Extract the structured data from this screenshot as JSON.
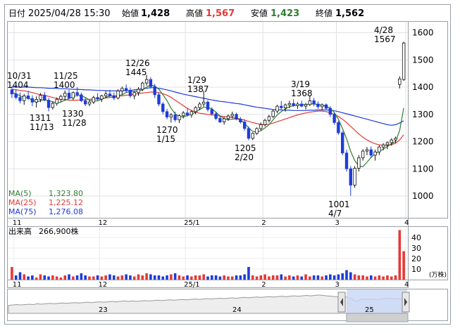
{
  "header": {
    "date_label": "日付",
    "datetime": "2025/04/28 15:30",
    "open_label": "始値",
    "open": "1,428",
    "high_label": "高値",
    "high": "1,567",
    "low_label": "安値",
    "low": "1,423",
    "close_label": "終値",
    "close": "1,562"
  },
  "ma_legend": [
    {
      "label": "MA(5)",
      "value": "1,323.80",
      "color": "#2e7d32"
    },
    {
      "label": "MA(25)",
      "value": "1,225.12",
      "color": "#e53935"
    },
    {
      "label": "MA(75)",
      "value": "1,276.08",
      "color": "#1e3cd8"
    }
  ],
  "volume_legend": {
    "label": "出来高",
    "value": "266,900株"
  },
  "volume_unit": "(万株)",
  "colors": {
    "up": "#e53935",
    "down": "#1e3cd8",
    "ma5": "#2e7d32",
    "ma25": "#e53935",
    "ma75": "#1e3cd8",
    "high_text": "#e53935",
    "low_text": "#2e7d32"
  },
  "chart_data": [
    {
      "type": "candlestick",
      "x_labels": [
        "11",
        "12",
        "25/1",
        "2",
        "3",
        "4"
      ],
      "ylim": [
        920,
        1640
      ],
      "y_ticks": [
        1000,
        1100,
        1200,
        1300,
        1400,
        1500,
        1600
      ],
      "grid": true,
      "annotations": [
        {
          "date": "10/31",
          "value": "1404"
        },
        {
          "date": "11/13",
          "value": "1311"
        },
        {
          "date": "11/25",
          "value": "1400"
        },
        {
          "date": "11/28",
          "value": "1330"
        },
        {
          "date": "12/26",
          "value": "1445"
        },
        {
          "date": "1/15",
          "value": "1270"
        },
        {
          "date": "1/29",
          "value": "1387"
        },
        {
          "date": "2/20",
          "value": "1205"
        },
        {
          "date": "3/19",
          "value": "1368"
        },
        {
          "date": "4/7",
          "value": "1001"
        },
        {
          "date": "4/28",
          "value": "1567"
        }
      ],
      "candles": [
        [
          1390,
          1404,
          1360,
          1375
        ],
        [
          1375,
          1392,
          1355,
          1362
        ],
        [
          1362,
          1380,
          1340,
          1350
        ],
        [
          1350,
          1375,
          1335,
          1368
        ],
        [
          1368,
          1386,
          1352,
          1358
        ],
        [
          1358,
          1370,
          1330,
          1345
        ],
        [
          1345,
          1366,
          1325,
          1355
        ],
        [
          1355,
          1378,
          1345,
          1370
        ],
        [
          1370,
          1382,
          1348,
          1352
        ],
        [
          1352,
          1360,
          1311,
          1325
        ],
        [
          1325,
          1348,
          1318,
          1340
        ],
        [
          1340,
          1362,
          1332,
          1355
        ],
        [
          1355,
          1372,
          1345,
          1366
        ],
        [
          1366,
          1388,
          1350,
          1378
        ],
        [
          1378,
          1390,
          1355,
          1360
        ],
        [
          1360,
          1384,
          1352,
          1380
        ],
        [
          1380,
          1400,
          1365,
          1372
        ],
        [
          1372,
          1380,
          1345,
          1350
        ],
        [
          1350,
          1362,
          1330,
          1338
        ],
        [
          1338,
          1352,
          1330,
          1345
        ],
        [
          1345,
          1368,
          1338,
          1362
        ],
        [
          1362,
          1378,
          1350,
          1356
        ],
        [
          1356,
          1372,
          1345,
          1368
        ],
        [
          1368,
          1385,
          1360,
          1375
        ],
        [
          1375,
          1390,
          1362,
          1368
        ],
        [
          1368,
          1380,
          1352,
          1360
        ],
        [
          1360,
          1392,
          1355,
          1386
        ],
        [
          1386,
          1402,
          1372,
          1395
        ],
        [
          1395,
          1410,
          1380,
          1388
        ],
        [
          1388,
          1398,
          1360,
          1368
        ],
        [
          1368,
          1386,
          1355,
          1380
        ],
        [
          1380,
          1400,
          1368,
          1392
        ],
        [
          1392,
          1420,
          1385,
          1415
        ],
        [
          1415,
          1445,
          1405,
          1428
        ],
        [
          1428,
          1436,
          1395,
          1402
        ],
        [
          1402,
          1412,
          1360,
          1372
        ],
        [
          1372,
          1380,
          1330,
          1338
        ],
        [
          1338,
          1345,
          1300,
          1310
        ],
        [
          1310,
          1320,
          1282,
          1290
        ],
        [
          1290,
          1305,
          1270,
          1298
        ],
        [
          1298,
          1310,
          1272,
          1280
        ],
        [
          1280,
          1300,
          1268,
          1295
        ],
        [
          1295,
          1312,
          1285,
          1305
        ],
        [
          1305,
          1322,
          1292,
          1298
        ],
        [
          1298,
          1315,
          1288,
          1310
        ],
        [
          1310,
          1330,
          1300,
          1325
        ],
        [
          1325,
          1345,
          1315,
          1338
        ],
        [
          1338,
          1387,
          1328,
          1345
        ],
        [
          1345,
          1352,
          1310,
          1318
        ],
        [
          1318,
          1326,
          1296,
          1302
        ],
        [
          1302,
          1310,
          1278,
          1285
        ],
        [
          1285,
          1295,
          1268,
          1272
        ],
        [
          1272,
          1290,
          1262,
          1284
        ],
        [
          1284,
          1300,
          1276,
          1294
        ],
        [
          1294,
          1310,
          1285,
          1300
        ],
        [
          1300,
          1306,
          1278,
          1282
        ],
        [
          1282,
          1290,
          1266,
          1272
        ],
        [
          1272,
          1282,
          1240,
          1248
        ],
        [
          1248,
          1256,
          1205,
          1212
        ],
        [
          1212,
          1234,
          1205,
          1230
        ],
        [
          1230,
          1252,
          1224,
          1248
        ],
        [
          1248,
          1270,
          1240,
          1262
        ],
        [
          1262,
          1284,
          1255,
          1278
        ],
        [
          1278,
          1298,
          1270,
          1292
        ],
        [
          1292,
          1318,
          1286,
          1312
        ],
        [
          1312,
          1335,
          1304,
          1330
        ],
        [
          1330,
          1348,
          1318,
          1324
        ],
        [
          1324,
          1340,
          1310,
          1335
        ],
        [
          1335,
          1350,
          1322,
          1340
        ],
        [
          1340,
          1355,
          1328,
          1332
        ],
        [
          1332,
          1345,
          1320,
          1338
        ],
        [
          1338,
          1350,
          1326,
          1330
        ],
        [
          1330,
          1342,
          1318,
          1336
        ],
        [
          1336,
          1368,
          1330,
          1350
        ],
        [
          1350,
          1360,
          1330,
          1338
        ],
        [
          1338,
          1348,
          1320,
          1328
        ],
        [
          1328,
          1340,
          1315,
          1335
        ],
        [
          1335,
          1340,
          1318,
          1322
        ],
        [
          1322,
          1330,
          1290,
          1300
        ],
        [
          1300,
          1306,
          1262,
          1270
        ],
        [
          1270,
          1276,
          1225,
          1232
        ],
        [
          1232,
          1238,
          1150,
          1158
        ],
        [
          1158,
          1170,
          1090,
          1100
        ],
        [
          1100,
          1110,
          1001,
          1040
        ],
        [
          1040,
          1110,
          1030,
          1102
        ],
        [
          1102,
          1150,
          1090,
          1140
        ],
        [
          1140,
          1172,
          1130,
          1165
        ],
        [
          1165,
          1180,
          1150,
          1170
        ],
        [
          1170,
          1182,
          1140,
          1150
        ],
        [
          1150,
          1170,
          1130,
          1162
        ],
        [
          1162,
          1186,
          1150,
          1180
        ],
        [
          1180,
          1194,
          1168,
          1188
        ],
        [
          1188,
          1200,
          1172,
          1196
        ],
        [
          1196,
          1212,
          1185,
          1206
        ],
        [
          1206,
          1218,
          1195,
          1212
        ],
        [
          1410,
          1440,
          1395,
          1430
        ],
        [
          1428,
          1567,
          1423,
          1562
        ]
      ],
      "ma5": [
        1380,
        1376,
        1368,
        1362,
        1360,
        1352,
        1345,
        1350,
        1354,
        1350,
        1346,
        1342,
        1345,
        1352,
        1358,
        1364,
        1370,
        1368,
        1362,
        1352,
        1348,
        1350,
        1355,
        1362,
        1368,
        1368,
        1368,
        1372,
        1380,
        1384,
        1384,
        1386,
        1390,
        1400,
        1408,
        1404,
        1392,
        1372,
        1350,
        1322,
        1302,
        1292,
        1290,
        1296,
        1300,
        1308,
        1318,
        1326,
        1326,
        1320,
        1308,
        1294,
        1284,
        1280,
        1282,
        1284,
        1280,
        1268,
        1250,
        1238,
        1234,
        1240,
        1250,
        1262,
        1280,
        1298,
        1310,
        1320,
        1328,
        1332,
        1334,
        1336,
        1336,
        1338,
        1338,
        1336,
        1334,
        1330,
        1322,
        1306,
        1282,
        1248,
        1210,
        1164,
        1130,
        1110,
        1108,
        1124,
        1142,
        1154,
        1164,
        1172,
        1182,
        1192,
        1200,
        1240,
        1323
      ],
      "ma25": [
        1392,
        1390,
        1388,
        1386,
        1384,
        1380,
        1376,
        1372,
        1370,
        1366,
        1362,
        1358,
        1356,
        1354,
        1352,
        1352,
        1352,
        1353,
        1354,
        1355,
        1356,
        1357,
        1358,
        1360,
        1362,
        1364,
        1366,
        1368,
        1370,
        1372,
        1374,
        1376,
        1378,
        1380,
        1382,
        1382,
        1380,
        1376,
        1370,
        1362,
        1352,
        1342,
        1332,
        1322,
        1314,
        1308,
        1304,
        1302,
        1300,
        1298,
        1296,
        1294,
        1292,
        1290,
        1288,
        1286,
        1283,
        1279,
        1274,
        1270,
        1266,
        1263,
        1262,
        1264,
        1268,
        1273,
        1278,
        1283,
        1288,
        1293,
        1298,
        1302,
        1305,
        1308,
        1310,
        1312,
        1312,
        1310,
        1306,
        1300,
        1292,
        1282,
        1270,
        1256,
        1242,
        1228,
        1216,
        1206,
        1198,
        1192,
        1188,
        1186,
        1186,
        1188,
        1194,
        1206,
        1225
      ],
      "ma75": [
        1400,
        1400,
        1400,
        1400,
        1400,
        1399,
        1398,
        1398,
        1397,
        1396,
        1396,
        1395,
        1394,
        1394,
        1393,
        1392,
        1392,
        1391,
        1390,
        1390,
        1389,
        1388,
        1388,
        1387,
        1386,
        1386,
        1386,
        1386,
        1387,
        1388,
        1390,
        1392,
        1394,
        1396,
        1398,
        1398,
        1396,
        1393,
        1390,
        1386,
        1382,
        1378,
        1374,
        1371,
        1368,
        1365,
        1362,
        1359,
        1356,
        1353,
        1350,
        1348,
        1346,
        1344,
        1342,
        1340,
        1338,
        1335,
        1332,
        1329,
        1326,
        1324,
        1322,
        1320,
        1318,
        1317,
        1316,
        1315,
        1315,
        1314,
        1314,
        1314,
        1314,
        1315,
        1315,
        1316,
        1316,
        1316,
        1315,
        1313,
        1310,
        1306,
        1302,
        1298,
        1294,
        1290,
        1286,
        1282,
        1278,
        1274,
        1270,
        1266,
        1262,
        1260,
        1262,
        1268,
        1276
      ]
    },
    {
      "type": "bar",
      "series_name": "出来高",
      "unit": "万株",
      "ylim": [
        0,
        50
      ],
      "y_ticks": [
        10,
        20,
        30,
        40
      ],
      "values": [
        12,
        4,
        7,
        5,
        3,
        4,
        2,
        5,
        4,
        3,
        4,
        3,
        2,
        4,
        5,
        3,
        4,
        6,
        4,
        3,
        3,
        4,
        3,
        4,
        5,
        4,
        3,
        4,
        5,
        4,
        3,
        5,
        4,
        6,
        5,
        4,
        4,
        3,
        4,
        5,
        6,
        4,
        3,
        4,
        3,
        4,
        4,
        5,
        3,
        4,
        4,
        3,
        4,
        3,
        3,
        4,
        4,
        5,
        12,
        4,
        3,
        4,
        5,
        3,
        4,
        4,
        5,
        3,
        4,
        3,
        4,
        3,
        5,
        3,
        4,
        4,
        3,
        4,
        5,
        4,
        5,
        6,
        9,
        7,
        5,
        4,
        4,
        3,
        4,
        3,
        4,
        3,
        4,
        3,
        4,
        47,
        27
      ],
      "up_flags": [
        1,
        0,
        0,
        1,
        0,
        0,
        1,
        1,
        0,
        0,
        1,
        1,
        1,
        1,
        0,
        1,
        0,
        0,
        0,
        1,
        1,
        0,
        1,
        1,
        0,
        0,
        1,
        1,
        0,
        0,
        1,
        1,
        1,
        1,
        0,
        0,
        0,
        0,
        0,
        1,
        0,
        1,
        1,
        0,
        1,
        1,
        1,
        1,
        0,
        0,
        0,
        0,
        1,
        1,
        1,
        0,
        0,
        0,
        0,
        1,
        1,
        1,
        1,
        1,
        1,
        1,
        0,
        1,
        1,
        0,
        1,
        0,
        1,
        1,
        0,
        0,
        1,
        0,
        0,
        0,
        0,
        0,
        0,
        0,
        1,
        1,
        1,
        1,
        0,
        1,
        1,
        1,
        1,
        1,
        1,
        1,
        1
      ]
    },
    {
      "type": "area",
      "series_name": "navigator",
      "x_labels": [
        "23",
        "24",
        "25"
      ],
      "values": [
        20,
        21,
        22,
        21,
        22,
        23,
        22,
        24,
        23,
        24,
        25,
        24,
        25,
        26,
        25,
        26,
        27,
        26,
        27,
        28,
        27,
        28,
        29,
        28,
        29,
        30,
        29,
        30,
        31,
        30,
        31,
        30,
        31,
        32,
        31,
        32,
        33,
        32,
        33,
        34,
        33,
        34,
        35,
        34,
        35,
        36,
        35,
        36,
        37,
        36,
        37,
        38,
        37,
        38,
        39,
        38,
        39,
        40,
        39,
        40,
        41,
        40,
        41,
        42,
        41,
        42,
        43,
        42,
        43,
        44,
        43,
        44,
        45,
        44,
        45,
        46,
        45,
        44,
        43,
        42,
        41,
        42,
        40,
        36,
        30,
        34,
        36,
        35,
        36,
        34,
        36,
        37,
        38,
        36,
        37,
        36,
        38
      ]
    }
  ]
}
